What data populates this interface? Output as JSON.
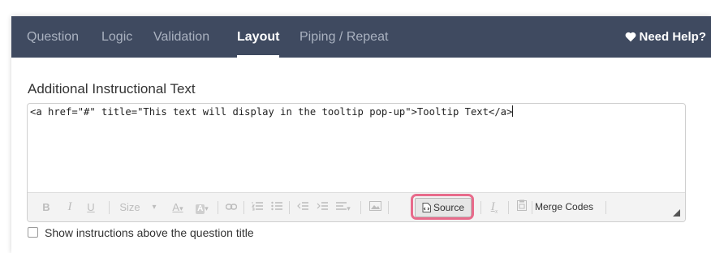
{
  "nav": {
    "tabs": [
      {
        "label": "Question",
        "active": false
      },
      {
        "label": "Logic",
        "active": false
      },
      {
        "label": "Validation",
        "active": false
      },
      {
        "label": "Layout",
        "active": true
      },
      {
        "label": "Piping / Repeat",
        "active": false
      }
    ],
    "help_label": "Need Help?",
    "help_icon": "heart-icon"
  },
  "section": {
    "title": "Additional Instructional Text"
  },
  "editor": {
    "content": "<a href=\"#\" title=\"This text will display in the tooltip pop-up\">Tooltip Text</a>",
    "toolbar": {
      "bold": "B",
      "italic": "I",
      "underline": "U",
      "size_label": "Size",
      "size_arrow": "▾",
      "text_color": "A",
      "bg_color": "A",
      "source_label": "Source",
      "merge_codes_label": "Merge Codes"
    }
  },
  "options": {
    "show_above_title_label": "Show instructions above the question title",
    "show_above_title_checked": false
  },
  "colors": {
    "nav_bg": "#3f4a60",
    "nav_inactive": "#aab2c0",
    "highlight": "#e86b8b"
  }
}
